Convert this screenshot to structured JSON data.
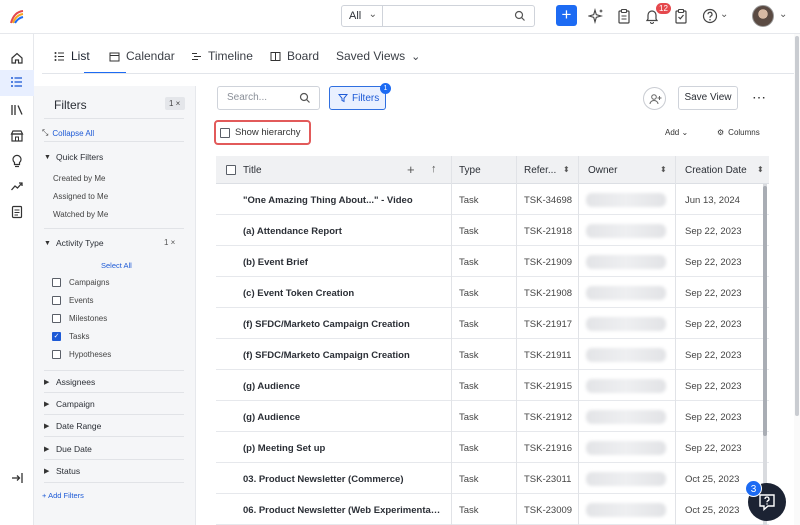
{
  "topbar": {
    "scope_select": "All",
    "notification_count": "12",
    "colors": {
      "accent": "#1d6bf3",
      "badge": "#e5484d"
    }
  },
  "tabs": [
    {
      "label": "List",
      "icon": "list-icon"
    },
    {
      "label": "Calendar",
      "icon": "calendar-icon"
    },
    {
      "label": "Timeline",
      "icon": "timeline-icon"
    },
    {
      "label": "Board",
      "icon": "board-icon"
    },
    {
      "label": "Saved Views",
      "icon": "chevron-down-icon"
    }
  ],
  "filters_panel": {
    "title": "Filters",
    "count": "1 ×",
    "collapse_all": "Collapse All",
    "quick_filters": {
      "label": "Quick Filters",
      "items": [
        "Created by Me",
        "Assigned to Me",
        "Watched by Me"
      ]
    },
    "activity_type": {
      "label": "Activity Type",
      "count": "1 ×",
      "select_all": "Select All",
      "options": [
        {
          "label": "Campaigns",
          "checked": false
        },
        {
          "label": "Events",
          "checked": false
        },
        {
          "label": "Milestones",
          "checked": false
        },
        {
          "label": "Tasks",
          "checked": true
        },
        {
          "label": "Hypotheses",
          "checked": false
        }
      ]
    },
    "collapsed_sections": [
      "Assignees",
      "Campaign",
      "Date Range",
      "Due Date",
      "Status"
    ],
    "add_filters": "Add Filters"
  },
  "toolbar": {
    "search_placeholder": "Search...",
    "filters_label": "Filters",
    "filters_badge": "1",
    "save_view": "Save View",
    "show_hierarchy": "Show hierarchy",
    "add": "Add",
    "columns": "Columns"
  },
  "table": {
    "columns": [
      "Title",
      "Type",
      "Refer...",
      "Owner",
      "Creation Date"
    ],
    "rows": [
      {
        "title": "\"One Amazing Thing About...\" - Video",
        "type": "Task",
        "ref": "TSK-34698",
        "date": "Jun 13, 2024"
      },
      {
        "title": "(a) Attendance Report",
        "type": "Task",
        "ref": "TSK-21918",
        "date": "Sep 22, 2023"
      },
      {
        "title": "(b) Event Brief",
        "type": "Task",
        "ref": "TSK-21909",
        "date": "Sep 22, 2023"
      },
      {
        "title": "(c) Event Token Creation",
        "type": "Task",
        "ref": "TSK-21908",
        "date": "Sep 22, 2023"
      },
      {
        "title": "(f) SFDC/Marketo Campaign Creation",
        "type": "Task",
        "ref": "TSK-21917",
        "date": "Sep 22, 2023"
      },
      {
        "title": "(f) SFDC/Marketo Campaign Creation",
        "type": "Task",
        "ref": "TSK-21911",
        "date": "Sep 22, 2023"
      },
      {
        "title": "(g) Audience",
        "type": "Task",
        "ref": "TSK-21915",
        "date": "Sep 22, 2023"
      },
      {
        "title": "(g) Audience",
        "type": "Task",
        "ref": "TSK-21912",
        "date": "Sep 22, 2023"
      },
      {
        "title": "(p) Meeting Set up",
        "type": "Task",
        "ref": "TSK-21916",
        "date": "Sep 22, 2023"
      },
      {
        "title": "03. Product Newsletter (Commerce)",
        "type": "Task",
        "ref": "TSK-23011",
        "date": "Oct 25, 2023"
      },
      {
        "title": "06. Product Newsletter (Web Experimentat...",
        "type": "Task",
        "ref": "TSK-23009",
        "date": "Oct 25, 2023"
      }
    ]
  },
  "help": {
    "badge": "3"
  }
}
